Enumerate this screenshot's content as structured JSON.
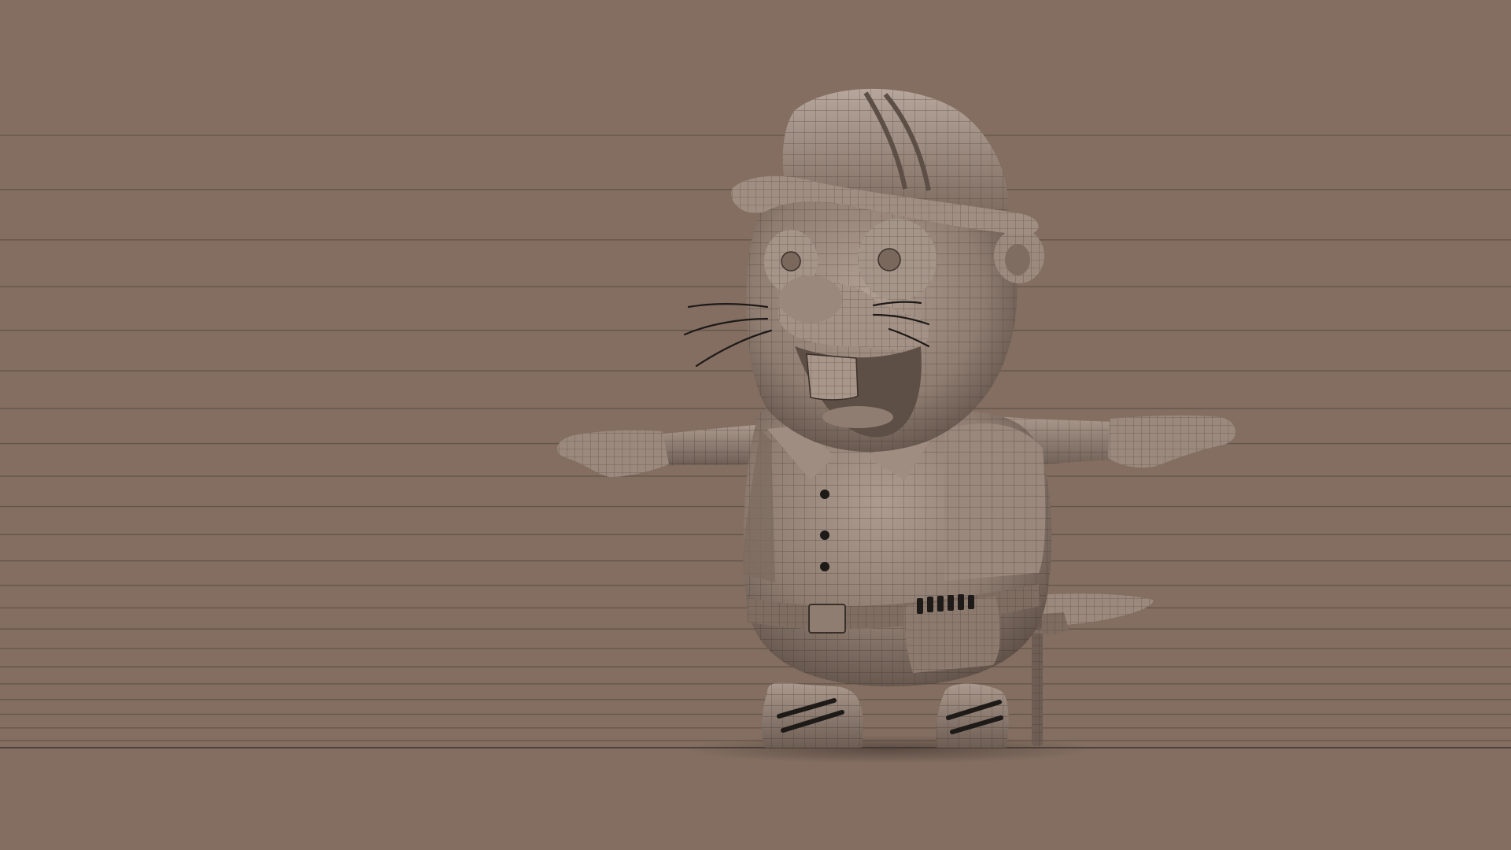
{
  "scene": {
    "subject": "beaver-construction-worker",
    "render_mode": "wireframe-on-shaded",
    "pose": "t-pose"
  },
  "colors": {
    "background": "#836e61",
    "floor_line": "#5a4c43",
    "model_light": "#a8968a",
    "model_mid": "#8e7c70",
    "model_dark": "#5e4f46",
    "wire": "#3a302a",
    "detail_dark": "#1e1a18"
  },
  "icons": {
    "hard_hat": "hard-hat-icon",
    "tool_belt": "tool-belt-icon",
    "hammer": "hammer-icon"
  }
}
